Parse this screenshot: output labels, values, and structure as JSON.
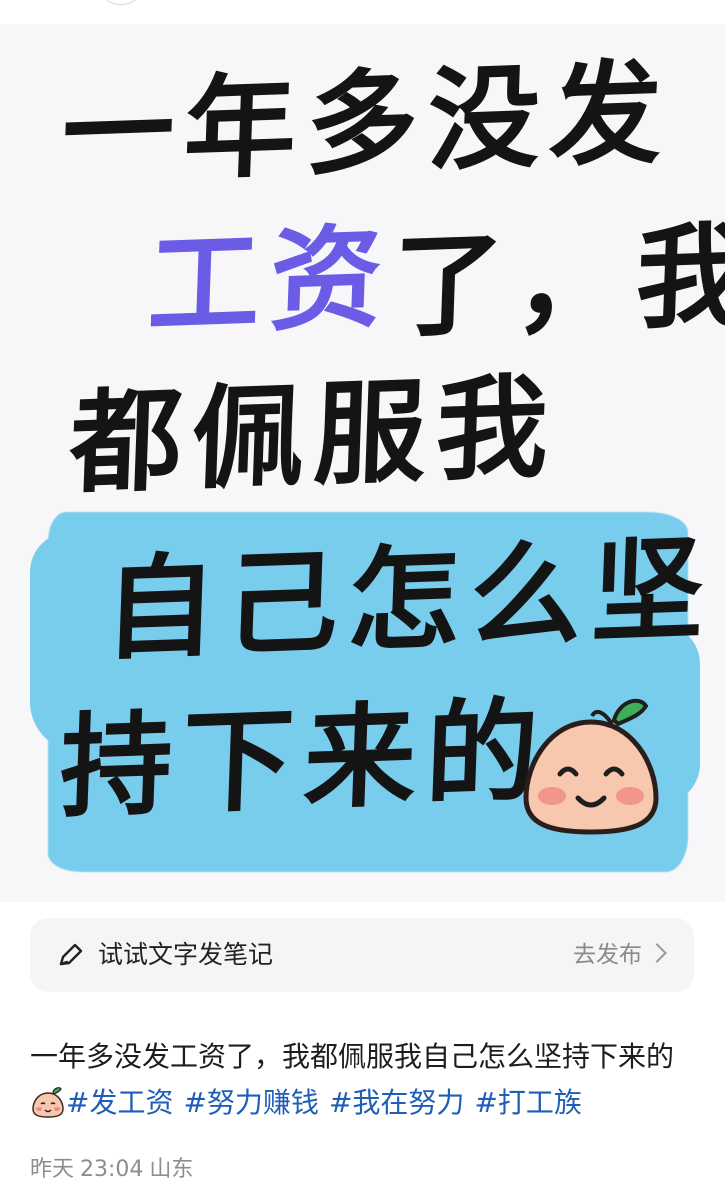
{
  "image_text": {
    "line1": "一年多没发",
    "line2_accent": "工资",
    "line2_rest": "了，我",
    "line3": "都佩服我",
    "line4": "自己怎么坚",
    "line5": "持下来的"
  },
  "composer": {
    "label": "试试文字发笔记",
    "action": "去发布"
  },
  "post": {
    "text": "一年多没发工资了，我都佩服我自己怎么坚持下来的",
    "tags": [
      "#发工资",
      "#努力赚钱",
      "#我在努力",
      "#打工族"
    ]
  },
  "meta": {
    "date": "昨天",
    "time": "23:04",
    "location": "山东"
  },
  "colors": {
    "accent_purple": "#6b5ce6",
    "highlight_blue": "#79cdec",
    "tag_blue": "#1f5eb8"
  },
  "icons": [
    "pencil-icon",
    "chevron-right-icon",
    "peach-emoji-icon"
  ]
}
